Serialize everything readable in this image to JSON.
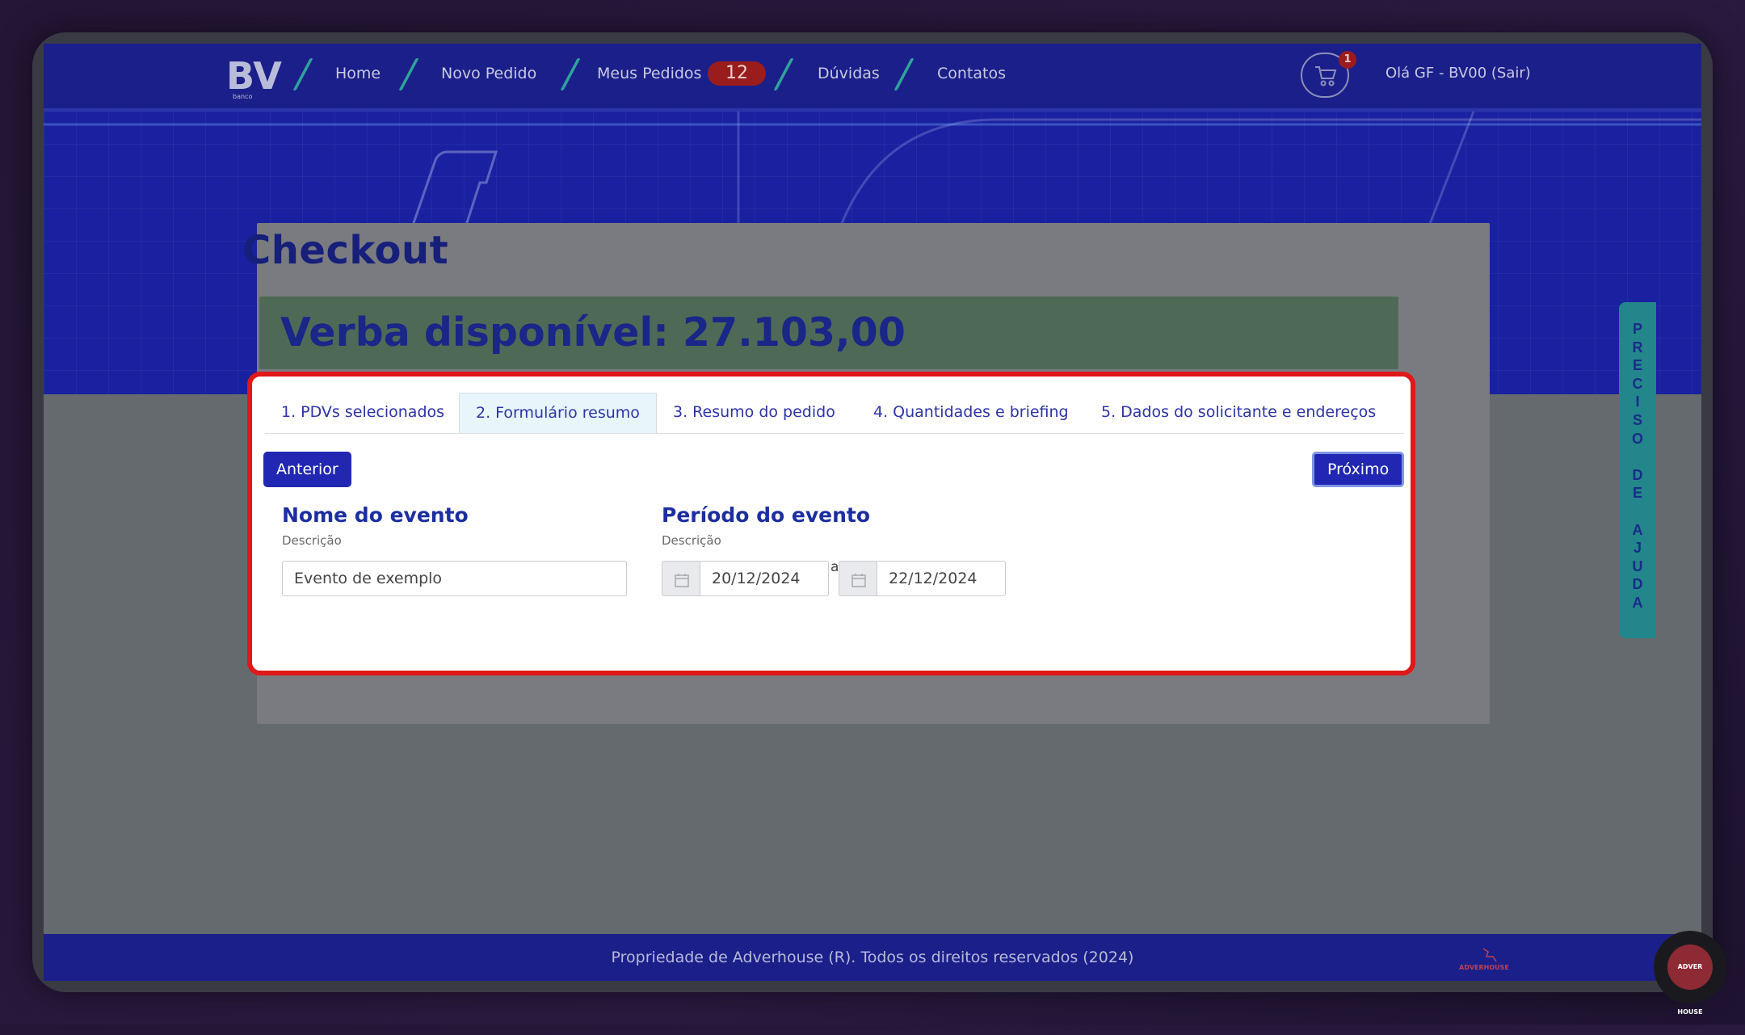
{
  "nav": {
    "logo_text": "BV",
    "logo_sub": "banco",
    "links": [
      "Home",
      "Novo Pedido",
      "Meus Pedidos",
      "Dúvidas",
      "Contatos"
    ],
    "orders_count": "12",
    "cart_count": "1",
    "greeting": "Olá GF - BV00 (Sair)"
  },
  "page": {
    "title": "Checkout",
    "verba": "Verba disponível: 27.103,00"
  },
  "tabs": [
    "1. PDVs selecionados",
    "2. Formulário resumo",
    "3. Resumo do pedido",
    "4. Quantidades e briefing",
    "5. Dados do solicitante e endereços"
  ],
  "active_tab": 1,
  "buttons": {
    "prev": "Anterior",
    "next": "Próximo"
  },
  "form": {
    "event_name": {
      "title": "Nome do evento",
      "subtitle": "Descrição",
      "value": "Evento de exemplo"
    },
    "event_period": {
      "title": "Período do evento",
      "subtitle": "Descrição",
      "start": "20/12/2024",
      "separator": "a",
      "end": "22/12/2024"
    }
  },
  "help_tab": [
    "P",
    "R",
    "E",
    "C",
    "I",
    "S",
    "O",
    "",
    "D",
    "E",
    "",
    "A",
    "J",
    "U",
    "D",
    "A"
  ],
  "footer": {
    "text": "Propriedade de Adverhouse (R). Todos os direitos reservados (2024)",
    "logo_text": "ADVERHOUSE"
  },
  "chat_label": "ADVER HOUSE",
  "colors": {
    "nav_bg": "#1b1f8a",
    "primary_button": "#2127b3",
    "highlight_border": "#e01818",
    "help_tab": "#23868a"
  }
}
